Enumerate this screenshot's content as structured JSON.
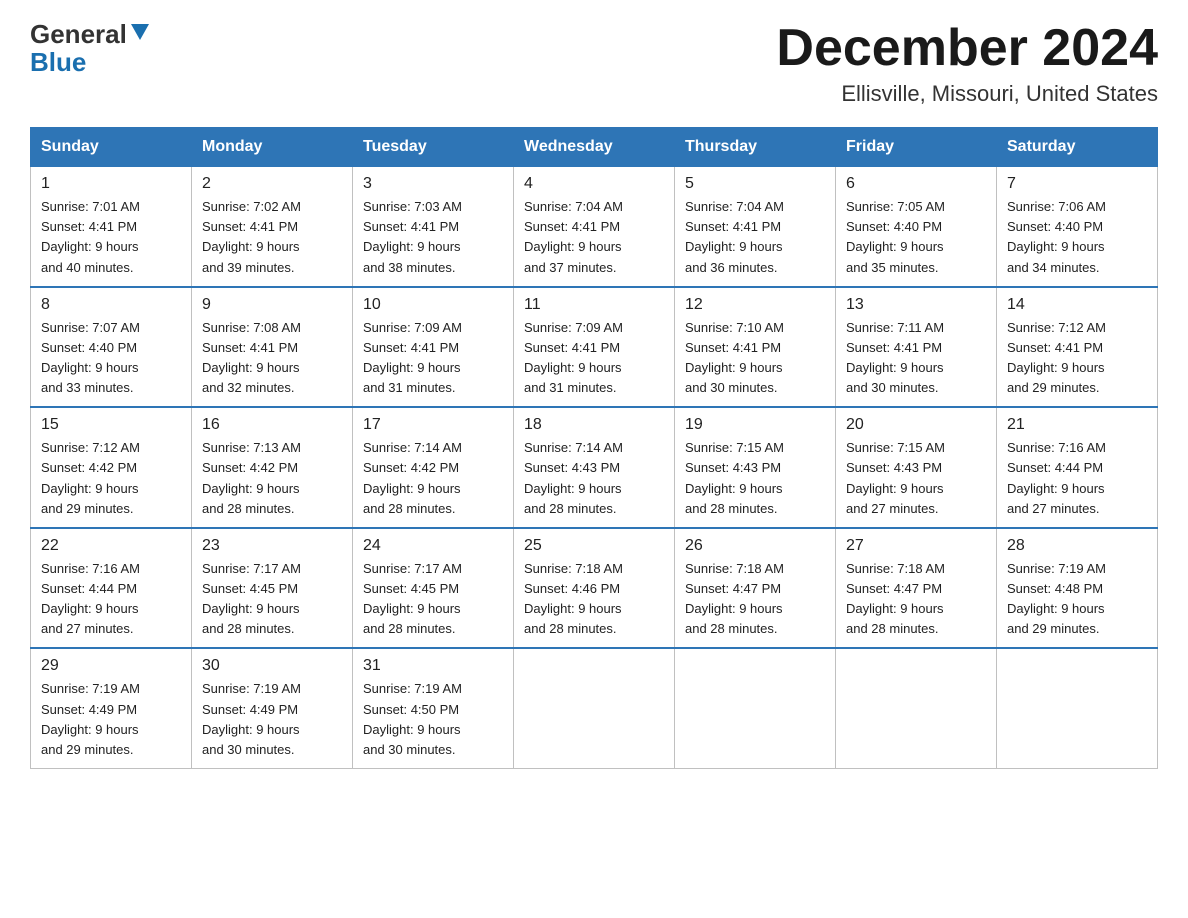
{
  "header": {
    "logo_general": "General",
    "logo_blue": "Blue",
    "month_title": "December 2024",
    "location": "Ellisville, Missouri, United States"
  },
  "days_of_week": [
    "Sunday",
    "Monday",
    "Tuesday",
    "Wednesday",
    "Thursday",
    "Friday",
    "Saturday"
  ],
  "weeks": [
    [
      {
        "day": "1",
        "sunrise": "7:01 AM",
        "sunset": "4:41 PM",
        "daylight": "9 hours and 40 minutes."
      },
      {
        "day": "2",
        "sunrise": "7:02 AM",
        "sunset": "4:41 PM",
        "daylight": "9 hours and 39 minutes."
      },
      {
        "day": "3",
        "sunrise": "7:03 AM",
        "sunset": "4:41 PM",
        "daylight": "9 hours and 38 minutes."
      },
      {
        "day": "4",
        "sunrise": "7:04 AM",
        "sunset": "4:41 PM",
        "daylight": "9 hours and 37 minutes."
      },
      {
        "day": "5",
        "sunrise": "7:04 AM",
        "sunset": "4:41 PM",
        "daylight": "9 hours and 36 minutes."
      },
      {
        "day": "6",
        "sunrise": "7:05 AM",
        "sunset": "4:40 PM",
        "daylight": "9 hours and 35 minutes."
      },
      {
        "day": "7",
        "sunrise": "7:06 AM",
        "sunset": "4:40 PM",
        "daylight": "9 hours and 34 minutes."
      }
    ],
    [
      {
        "day": "8",
        "sunrise": "7:07 AM",
        "sunset": "4:40 PM",
        "daylight": "9 hours and 33 minutes."
      },
      {
        "day": "9",
        "sunrise": "7:08 AM",
        "sunset": "4:41 PM",
        "daylight": "9 hours and 32 minutes."
      },
      {
        "day": "10",
        "sunrise": "7:09 AM",
        "sunset": "4:41 PM",
        "daylight": "9 hours and 31 minutes."
      },
      {
        "day": "11",
        "sunrise": "7:09 AM",
        "sunset": "4:41 PM",
        "daylight": "9 hours and 31 minutes."
      },
      {
        "day": "12",
        "sunrise": "7:10 AM",
        "sunset": "4:41 PM",
        "daylight": "9 hours and 30 minutes."
      },
      {
        "day": "13",
        "sunrise": "7:11 AM",
        "sunset": "4:41 PM",
        "daylight": "9 hours and 30 minutes."
      },
      {
        "day": "14",
        "sunrise": "7:12 AM",
        "sunset": "4:41 PM",
        "daylight": "9 hours and 29 minutes."
      }
    ],
    [
      {
        "day": "15",
        "sunrise": "7:12 AM",
        "sunset": "4:42 PM",
        "daylight": "9 hours and 29 minutes."
      },
      {
        "day": "16",
        "sunrise": "7:13 AM",
        "sunset": "4:42 PM",
        "daylight": "9 hours and 28 minutes."
      },
      {
        "day": "17",
        "sunrise": "7:14 AM",
        "sunset": "4:42 PM",
        "daylight": "9 hours and 28 minutes."
      },
      {
        "day": "18",
        "sunrise": "7:14 AM",
        "sunset": "4:43 PM",
        "daylight": "9 hours and 28 minutes."
      },
      {
        "day": "19",
        "sunrise": "7:15 AM",
        "sunset": "4:43 PM",
        "daylight": "9 hours and 28 minutes."
      },
      {
        "day": "20",
        "sunrise": "7:15 AM",
        "sunset": "4:43 PM",
        "daylight": "9 hours and 27 minutes."
      },
      {
        "day": "21",
        "sunrise": "7:16 AM",
        "sunset": "4:44 PM",
        "daylight": "9 hours and 27 minutes."
      }
    ],
    [
      {
        "day": "22",
        "sunrise": "7:16 AM",
        "sunset": "4:44 PM",
        "daylight": "9 hours and 27 minutes."
      },
      {
        "day": "23",
        "sunrise": "7:17 AM",
        "sunset": "4:45 PM",
        "daylight": "9 hours and 28 minutes."
      },
      {
        "day": "24",
        "sunrise": "7:17 AM",
        "sunset": "4:45 PM",
        "daylight": "9 hours and 28 minutes."
      },
      {
        "day": "25",
        "sunrise": "7:18 AM",
        "sunset": "4:46 PM",
        "daylight": "9 hours and 28 minutes."
      },
      {
        "day": "26",
        "sunrise": "7:18 AM",
        "sunset": "4:47 PM",
        "daylight": "9 hours and 28 minutes."
      },
      {
        "day": "27",
        "sunrise": "7:18 AM",
        "sunset": "4:47 PM",
        "daylight": "9 hours and 28 minutes."
      },
      {
        "day": "28",
        "sunrise": "7:19 AM",
        "sunset": "4:48 PM",
        "daylight": "9 hours and 29 minutes."
      }
    ],
    [
      {
        "day": "29",
        "sunrise": "7:19 AM",
        "sunset": "4:49 PM",
        "daylight": "9 hours and 29 minutes."
      },
      {
        "day": "30",
        "sunrise": "7:19 AM",
        "sunset": "4:49 PM",
        "daylight": "9 hours and 30 minutes."
      },
      {
        "day": "31",
        "sunrise": "7:19 AM",
        "sunset": "4:50 PM",
        "daylight": "9 hours and 30 minutes."
      },
      null,
      null,
      null,
      null
    ]
  ],
  "labels": {
    "sunrise_prefix": "Sunrise: ",
    "sunset_prefix": "Sunset: ",
    "daylight_prefix": "Daylight: "
  }
}
